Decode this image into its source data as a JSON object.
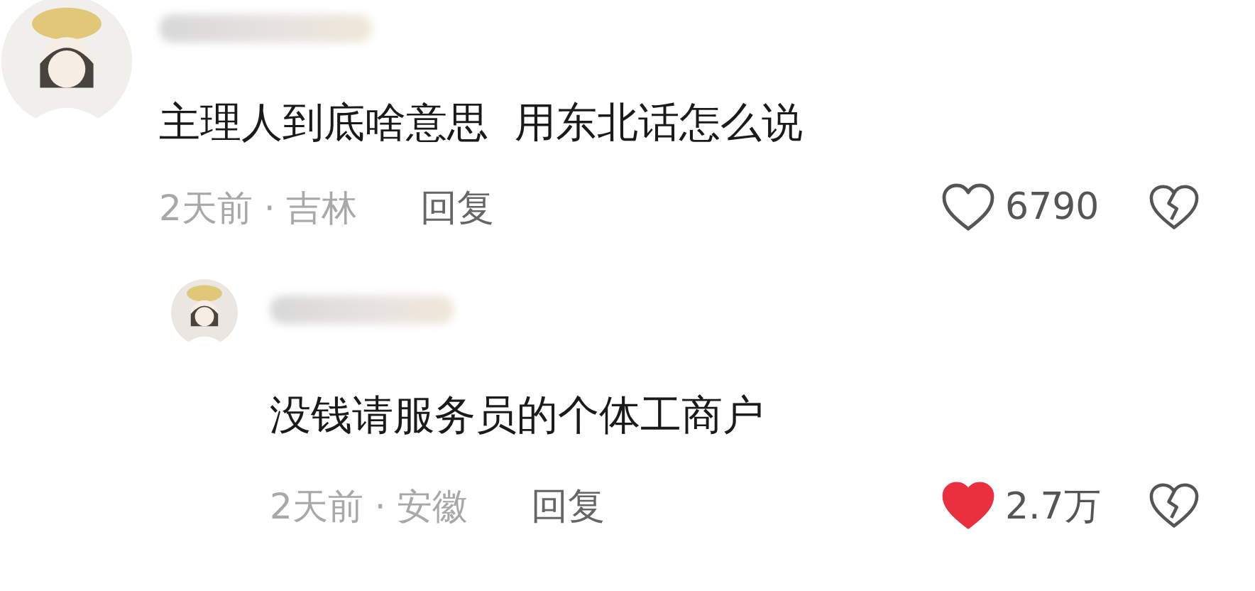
{
  "comments": [
    {
      "kind": "comment",
      "text": "主理人到底啥意思  用东北话怎么说",
      "meta": "2天前 · 吉林",
      "reply_label": "回复",
      "likes": "6790",
      "liked": false
    },
    {
      "kind": "reply",
      "text": "没钱请服务员的个体工商户",
      "meta": "2天前 · 安徽",
      "reply_label": "回复",
      "likes": "2.7万",
      "liked": true
    }
  ]
}
